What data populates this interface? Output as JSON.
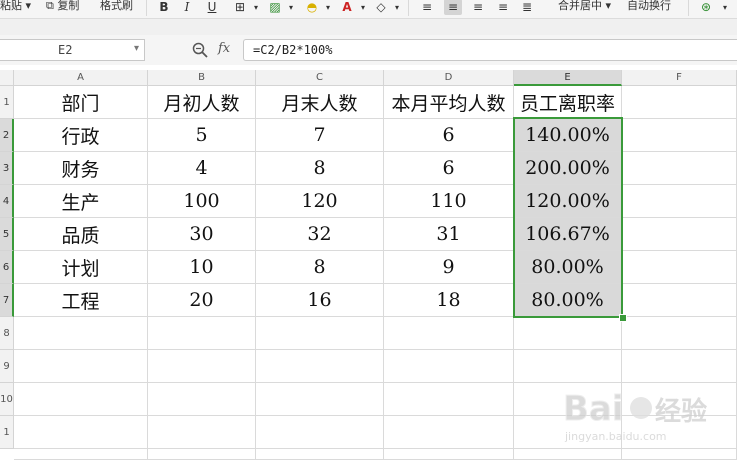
{
  "ribbon": {
    "paste": "粘贴",
    "copy": "复制",
    "format_painter": "格式刷",
    "bold": "B",
    "italic": "I",
    "underline": "U",
    "merge_center": "合并居中",
    "wrap_text": "自动换行"
  },
  "formula_bar": {
    "name_box": "E2",
    "fx_label": "fx",
    "formula": "=C2/B2*100%"
  },
  "columns": [
    "A",
    "B",
    "C",
    "D",
    "E",
    "F"
  ],
  "rows": [
    "1",
    "2",
    "3",
    "4",
    "5",
    "6",
    "7",
    "8",
    "9",
    "10",
    "1"
  ],
  "table": {
    "headers": [
      "部门",
      "月初人数",
      "月末人数",
      "本月平均人数",
      "员工离职率"
    ],
    "rows": [
      [
        "行政",
        "5",
        "7",
        "6",
        "140.00%"
      ],
      [
        "财务",
        "4",
        "8",
        "6",
        "200.00%"
      ],
      [
        "生产",
        "100",
        "120",
        "110",
        "120.00%"
      ],
      [
        "品质",
        "30",
        "32",
        "31",
        "106.67%"
      ],
      [
        "计划",
        "10",
        "8",
        "9",
        "80.00%"
      ],
      [
        "工程",
        "20",
        "16",
        "18",
        "80.00%"
      ]
    ]
  },
  "selection": "E2:E7",
  "accent_color": "#3a9a3a",
  "watermark": "Baidu经验 jingyan.baidu.com"
}
